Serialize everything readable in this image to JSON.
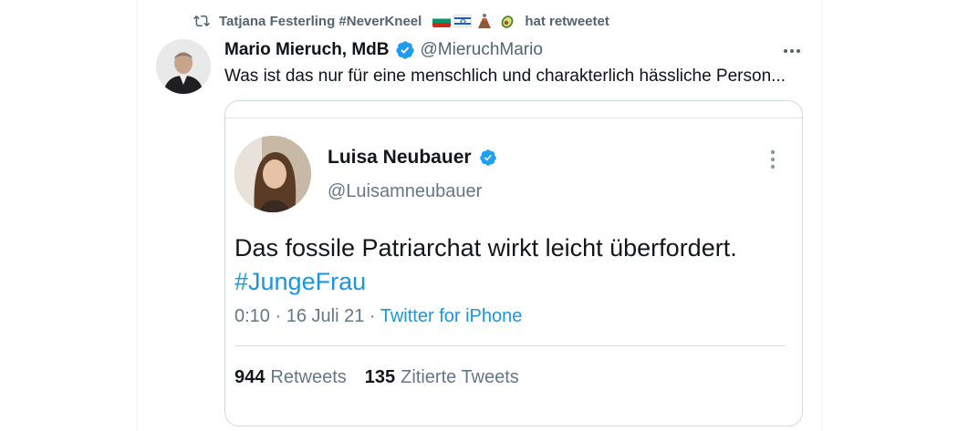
{
  "retweet": {
    "label": "Tatjana Festerling #NeverKneel",
    "suffix": "hat retweetet",
    "icon": "retweet-icon",
    "flags": [
      "bulgaria-flag-icon",
      "israel-flag-icon",
      "volcano-icon",
      "avocado-icon"
    ]
  },
  "tweet": {
    "author_name": "Mario Mieruch, MdB",
    "author_handle": "@MieruchMario",
    "text": "Was ist das nur für eine menschlich und charakterlich hässliche Person...",
    "more_icon": "more-horizontal-icon",
    "verified_color": "#1d9bf0"
  },
  "quoted": {
    "name": "Luisa Neubauer",
    "handle": "@Luisamneubauer",
    "text_line1": "Das fossile Patriarchat wirkt leicht überfordert.",
    "hashtag": "#JungeFrau",
    "meta_time": "0:10 · 16 Juli 21 · ",
    "meta_source": "Twitter for iPhone",
    "retweets_count": "944",
    "retweets_label": "Retweets",
    "quotes_count": "135",
    "quotes_label": "Zitierte Tweets",
    "link_color": "#1b95e0"
  }
}
